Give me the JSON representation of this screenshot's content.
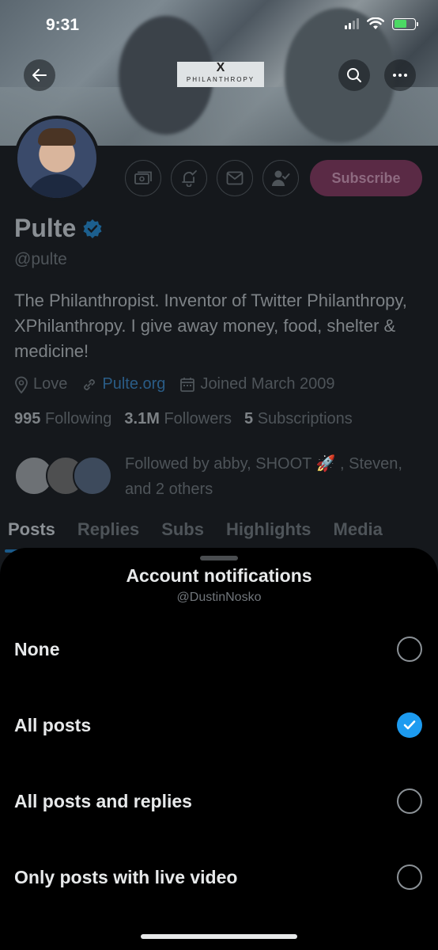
{
  "status_bar": {
    "time": "9:31"
  },
  "header": {
    "logo_mark": "X",
    "logo_text": "PHILANTHROPY"
  },
  "profile": {
    "name": "Pulte",
    "handle": "@pulte",
    "bio": "The Philanthropist. Inventor of Twitter Philanthropy, XPhilanthropy. I give away money, food, shelter & medicine!",
    "location": "Love",
    "website": "Pulte.org",
    "joined": "Joined March 2009",
    "following_count": "995",
    "following_label": "Following",
    "followers_count": "3.1M",
    "followers_label": "Followers",
    "subscriptions_count": "5",
    "subscriptions_label": "Subscriptions",
    "followed_by": "Followed by abby, SHOOT 🚀 , Steven, and 2 others",
    "subscribe_label": "Subscribe"
  },
  "tabs": [
    "Posts",
    "Replies",
    "Subs",
    "Highlights",
    "Media"
  ],
  "sheet": {
    "title": "Account notifications",
    "subtitle": "@DustinNosko",
    "options": [
      {
        "label": "None",
        "selected": false
      },
      {
        "label": "All posts",
        "selected": true
      },
      {
        "label": "All posts and replies",
        "selected": false
      },
      {
        "label": "Only posts with live video",
        "selected": false
      }
    ]
  },
  "colors": {
    "accent": "#1d9bf0",
    "subscribe_bg": "#5a2a45",
    "sheet_bg": "#000000"
  }
}
